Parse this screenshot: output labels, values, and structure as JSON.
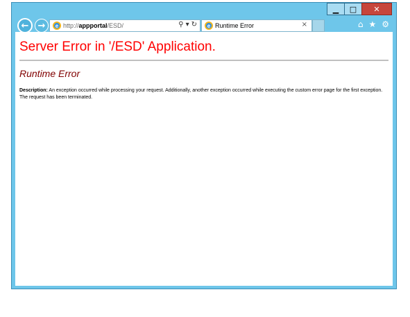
{
  "window": {
    "caption": {
      "minimize": "▁",
      "maximize": "□",
      "close": "✕"
    },
    "nav": {
      "back_icon": "back-arrow-icon",
      "forward_icon": "forward-arrow-icon"
    },
    "address": {
      "prefix": "http://",
      "host": "appportal",
      "path": "/ESD/",
      "search_icon": "⚲",
      "dropdown_icon": "▾",
      "refresh_icon": "↻"
    },
    "tab": {
      "title": "Runtime Error",
      "close": "×"
    },
    "toolbar": {
      "home": "⌂",
      "favorites": "★",
      "settings": "⚙"
    },
    "colors": {
      "frame": "#6ec6ea",
      "heading": "#ff0000",
      "subheading": "#800000"
    }
  },
  "page": {
    "title": "Server Error in '/ESD' Application.",
    "subtitle": "Runtime Error",
    "description_label": "Description:",
    "description_text": " An exception occurred while processing your request. Additionally, another exception occurred while executing the custom error page for the first exception. The request has been terminated."
  }
}
